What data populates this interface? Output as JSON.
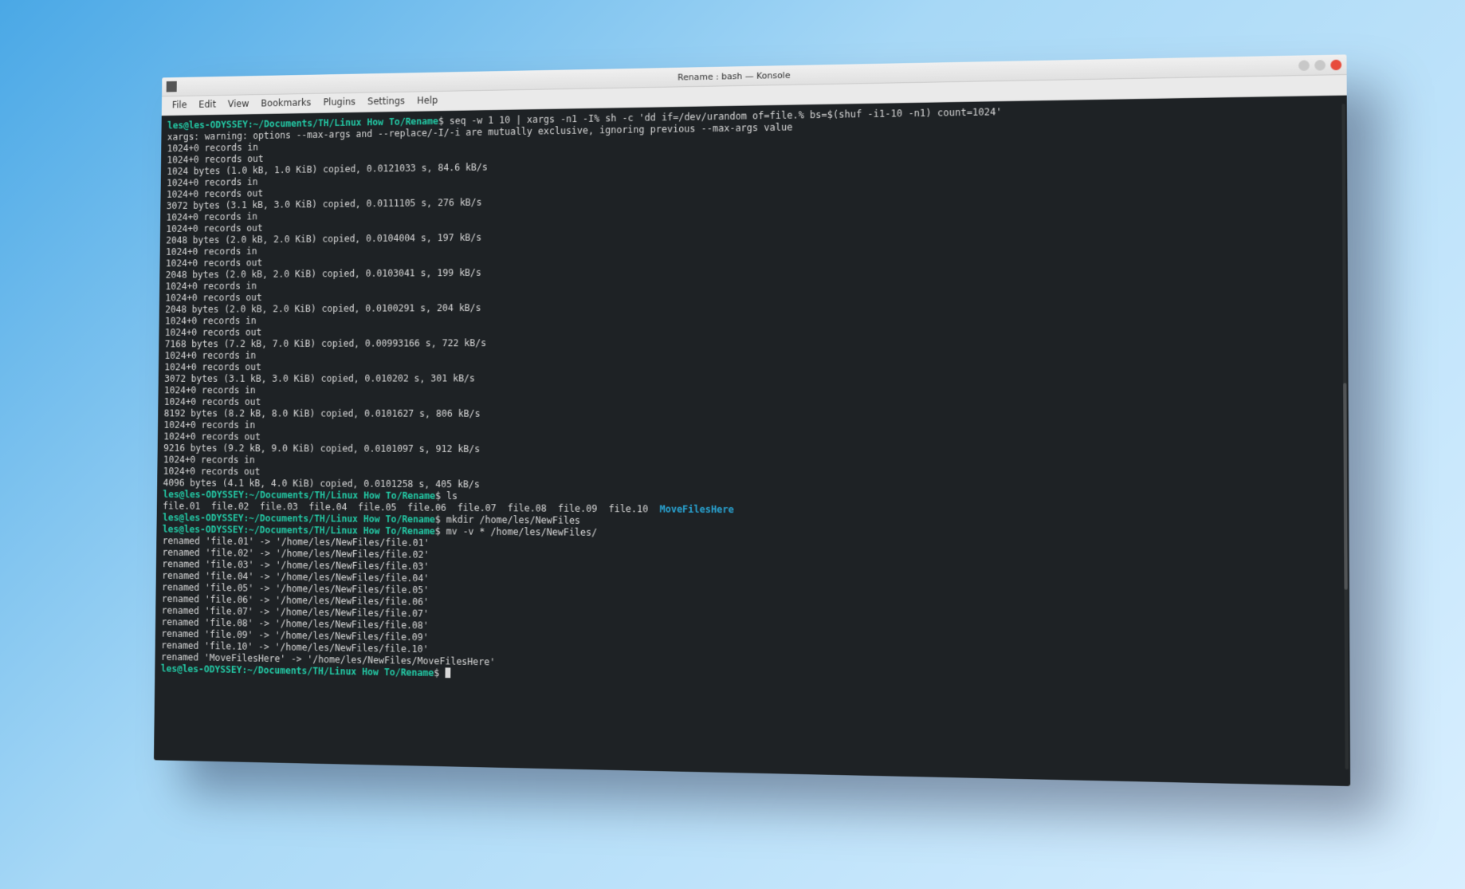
{
  "window": {
    "title": "Rename : bash — Konsole",
    "menubar": [
      "File",
      "Edit",
      "View",
      "Bookmarks",
      "Plugins",
      "Settings",
      "Help"
    ]
  },
  "prompt": {
    "user_host": "les@les-ODYSSEY",
    "path": "~/Documents/TH/Linux How To/Rename",
    "sigil": "$"
  },
  "session": {
    "cmd1": "seq -w 1 10 | xargs -n1 -I% sh -c 'dd if=/dev/urandom of=file.% bs=$(shuf -i1-10 -n1) count=1024'",
    "cmd1_output": [
      "xargs: warning: options --max-args and --replace/-I/-i are mutually exclusive, ignoring previous --max-args value",
      "1024+0 records in",
      "1024+0 records out",
      "1024 bytes (1.0 kB, 1.0 KiB) copied, 0.0121033 s, 84.6 kB/s",
      "1024+0 records in",
      "1024+0 records out",
      "3072 bytes (3.1 kB, 3.0 KiB) copied, 0.0111105 s, 276 kB/s",
      "1024+0 records in",
      "1024+0 records out",
      "2048 bytes (2.0 kB, 2.0 KiB) copied, 0.0104004 s, 197 kB/s",
      "1024+0 records in",
      "1024+0 records out",
      "2048 bytes (2.0 kB, 2.0 KiB) copied, 0.0103041 s, 199 kB/s",
      "1024+0 records in",
      "1024+0 records out",
      "2048 bytes (2.0 kB, 2.0 KiB) copied, 0.0100291 s, 204 kB/s",
      "1024+0 records in",
      "1024+0 records out",
      "7168 bytes (7.2 kB, 7.0 KiB) copied, 0.00993166 s, 722 kB/s",
      "1024+0 records in",
      "1024+0 records out",
      "3072 bytes (3.1 kB, 3.0 KiB) copied, 0.010202 s, 301 kB/s",
      "1024+0 records in",
      "1024+0 records out",
      "8192 bytes (8.2 kB, 8.0 KiB) copied, 0.0101627 s, 806 kB/s",
      "1024+0 records in",
      "1024+0 records out",
      "9216 bytes (9.2 kB, 9.0 KiB) copied, 0.0101097 s, 912 kB/s",
      "1024+0 records in",
      "1024+0 records out",
      "4096 bytes (4.1 kB, 4.0 KiB) copied, 0.0101258 s, 405 kB/s"
    ],
    "cmd2": "ls",
    "ls_files": [
      "file.01",
      "file.02",
      "file.03",
      "file.04",
      "file.05",
      "file.06",
      "file.07",
      "file.08",
      "file.09",
      "file.10"
    ],
    "ls_dir": "MoveFilesHere",
    "cmd3": "mkdir /home/les/NewFiles",
    "cmd4": "mv -v * /home/les/NewFiles/",
    "cmd4_output": [
      "renamed 'file.01' -> '/home/les/NewFiles/file.01'",
      "renamed 'file.02' -> '/home/les/NewFiles/file.02'",
      "renamed 'file.03' -> '/home/les/NewFiles/file.03'",
      "renamed 'file.04' -> '/home/les/NewFiles/file.04'",
      "renamed 'file.05' -> '/home/les/NewFiles/file.05'",
      "renamed 'file.06' -> '/home/les/NewFiles/file.06'",
      "renamed 'file.07' -> '/home/les/NewFiles/file.07'",
      "renamed 'file.08' -> '/home/les/NewFiles/file.08'",
      "renamed 'file.09' -> '/home/les/NewFiles/file.09'",
      "renamed 'file.10' -> '/home/les/NewFiles/file.10'",
      "renamed 'MoveFilesHere' -> '/home/les/NewFiles/MoveFilesHere'"
    ]
  }
}
